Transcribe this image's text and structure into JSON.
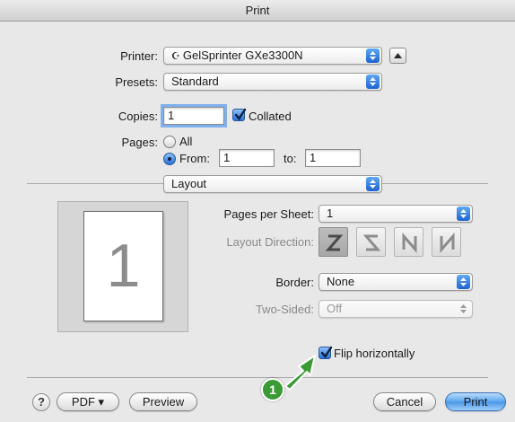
{
  "window": {
    "title": "Print"
  },
  "printer": {
    "label": "Printer:",
    "value": "GelSprinter GXe3300N",
    "status_glyph": "☪"
  },
  "presets": {
    "label": "Presets:",
    "value": "Standard"
  },
  "copies": {
    "label": "Copies:",
    "value": "1",
    "collated_label": "Collated",
    "collated_checked": true
  },
  "pages": {
    "label": "Pages:",
    "all_label": "All",
    "from_label": "From:",
    "from_value": "1",
    "to_label": "to:",
    "to_value": "1",
    "selected": "from"
  },
  "section": {
    "value": "Layout"
  },
  "preview": {
    "page_number": "1"
  },
  "layout": {
    "pages_per_sheet_label": "Pages per Sheet:",
    "pages_per_sheet_value": "1",
    "direction_label": "Layout Direction:",
    "direction_options": [
      "z-icon",
      "reverse-z-icon",
      "n-icon",
      "reverse-n-icon"
    ],
    "direction_selected": 0,
    "border_label": "Border:",
    "border_value": "None",
    "two_sided_label": "Two-Sided:",
    "two_sided_value": "Off",
    "flip_label": "Flip horizontally",
    "flip_checked": true
  },
  "footer": {
    "help_label": "?",
    "pdf_label": "PDF ▾",
    "preview_label": "Preview",
    "cancel_label": "Cancel",
    "print_label": "Print"
  },
  "callout": {
    "number": "1",
    "arrow_color": "#3a9a34"
  }
}
